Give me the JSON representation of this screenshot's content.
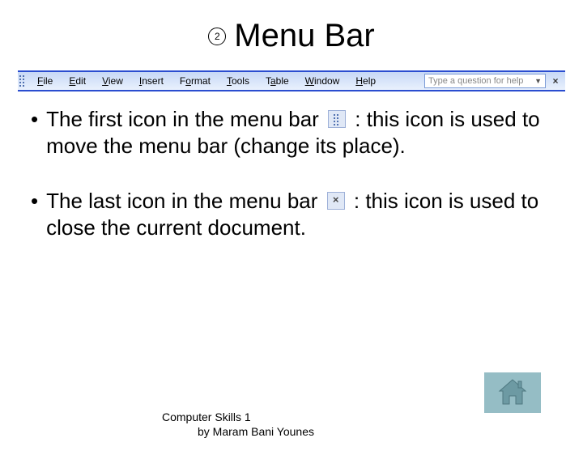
{
  "header": {
    "circle_number": "2",
    "title": "Menu Bar"
  },
  "menubar": {
    "items": [
      {
        "u": "F",
        "rest": "ile"
      },
      {
        "u": "E",
        "rest": "dit"
      },
      {
        "u": "V",
        "rest": "iew"
      },
      {
        "u": "I",
        "rest": "nsert"
      },
      {
        "u": "",
        "rest": "F",
        "u2": "o",
        "rest2": "rmat"
      },
      {
        "u": "T",
        "rest": "ools"
      },
      {
        "u": "",
        "rest": "T",
        "u2": "a",
        "rest2": "ble"
      },
      {
        "u": "W",
        "rest": "indow"
      },
      {
        "u": "H",
        "rest": "elp"
      }
    ],
    "help_placeholder": "Type a question for help",
    "close_glyph": "×"
  },
  "bullets": [
    {
      "pre": "The first icon in the menu bar ",
      "post": ": this icon is used to move the menu bar (change its place).",
      "icon": "drag"
    },
    {
      "pre": "The last icon in the menu bar ",
      "post": " : this icon is used to close the current document.",
      "icon": "close"
    }
  ],
  "footer": {
    "line1": "Computer Skills 1",
    "line2": "by Maram Bani Younes"
  }
}
